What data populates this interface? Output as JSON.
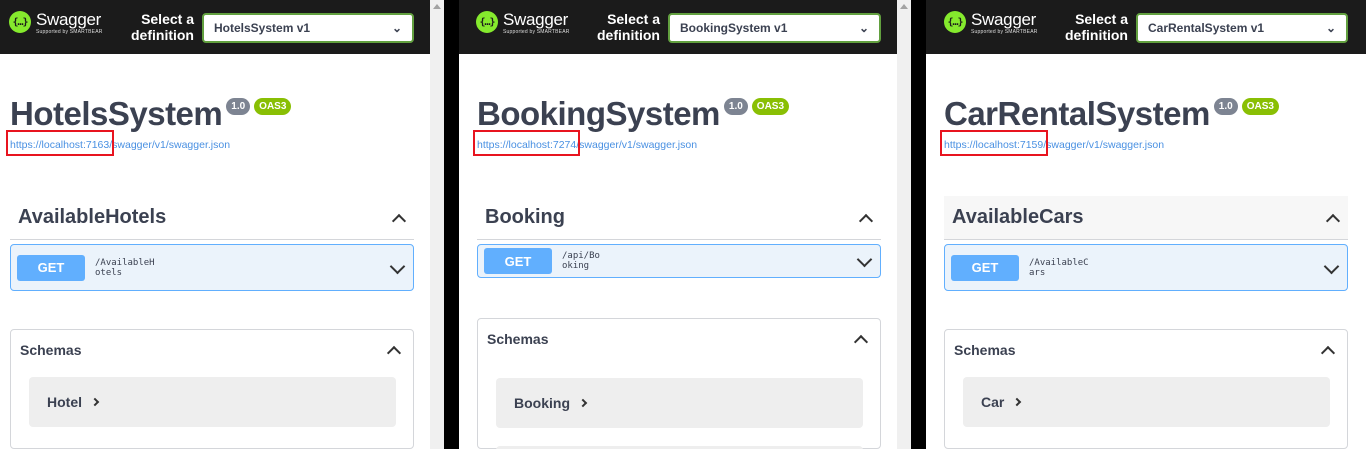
{
  "header": {
    "logo_name": "Swagger",
    "logo_sub": "Supported by SMARTBEAR",
    "definition_label_line1": "Select a",
    "definition_label_line2": "definition"
  },
  "colors": {
    "topbar": "#1b1b1b",
    "get_method": "#61affe",
    "oas_badge": "#89bf04",
    "version_badge": "#7d8492",
    "highlight": "#e8141f"
  },
  "panels": [
    {
      "definition": "HotelsSystem v1",
      "title": "HotelsSystem",
      "version": "1.0",
      "oas": "OAS3",
      "url": "https://localhost:7163/swagger/v1/swagger.json",
      "tag": "AvailableHotels",
      "method": "GET",
      "path": "/AvailableHotels",
      "schemas_title": "Schemas",
      "schema": "Hotel"
    },
    {
      "definition": "BookingSystem v1",
      "title": "BookingSystem",
      "version": "1.0",
      "oas": "OAS3",
      "url": "https://localhost:7274/swagger/v1/swagger.json",
      "tag": "Booking",
      "method": "GET",
      "path": "/api/Booking",
      "schemas_title": "Schemas",
      "schema": "Booking"
    },
    {
      "definition": "CarRentalSystem v1",
      "title": "CarRentalSystem",
      "version": "1.0",
      "oas": "OAS3",
      "url": "https://localhost:7159/swagger/v1/swagger.json",
      "tag": "AvailableCars",
      "method": "GET",
      "path": "/AvailableCars",
      "schemas_title": "Schemas",
      "schema": "Car"
    }
  ]
}
